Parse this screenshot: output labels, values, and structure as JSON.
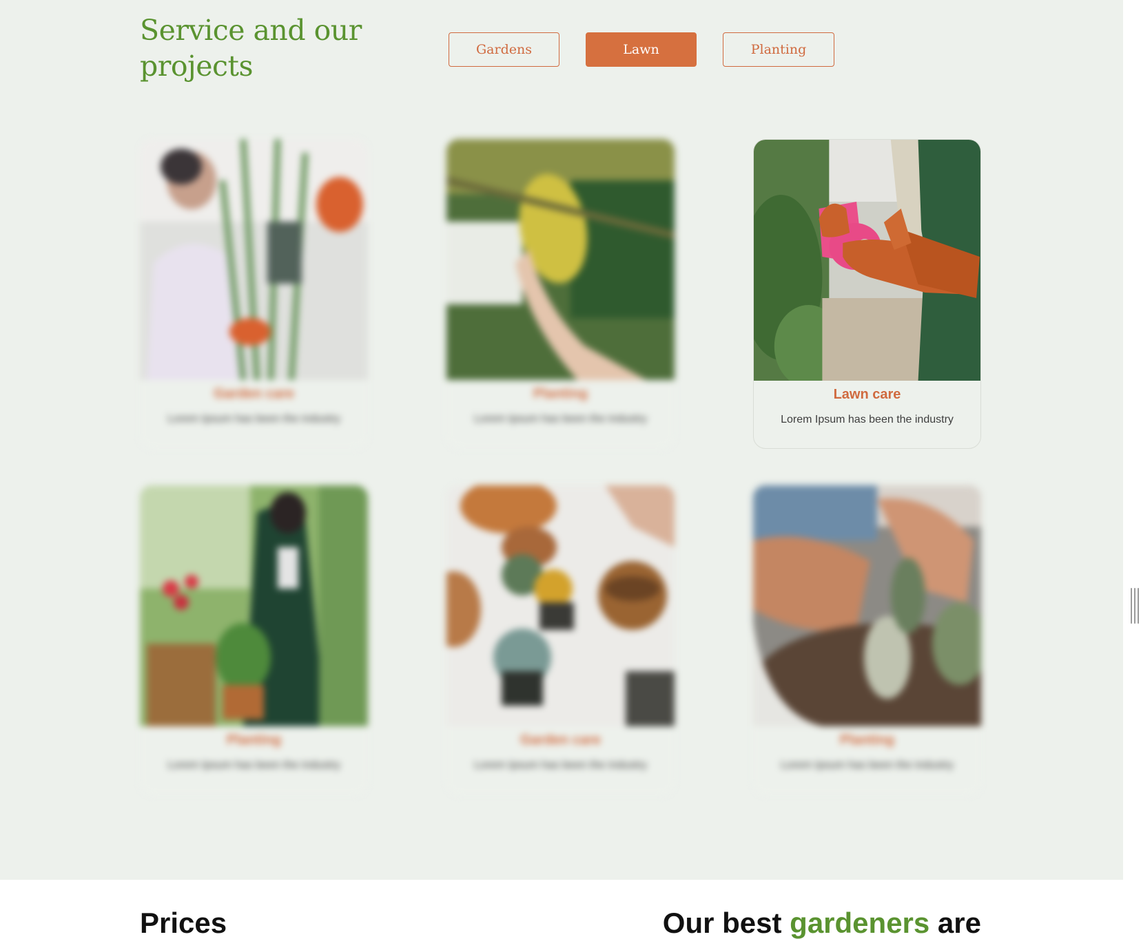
{
  "services": {
    "title": "Service and our projects",
    "filters": [
      {
        "label": "Gardens",
        "active": false
      },
      {
        "label": "Lawn",
        "active": true
      },
      {
        "label": "Planting",
        "active": false
      }
    ],
    "cards": [
      {
        "title": "Garden care",
        "description": "Lorem Ipsum has been the industry",
        "image": "gardener-with-plants-photo",
        "blurred": true
      },
      {
        "title": "Planting",
        "description": "Lorem Ipsum has been the industry",
        "image": "hand-holding-lemon-photo",
        "blurred": true
      },
      {
        "title": "Lawn care",
        "description": "Lorem Ipsum has been the industry",
        "image": "gloved-hands-spray-bottle-photo",
        "blurred": false
      },
      {
        "title": "Planting",
        "description": "Lorem Ipsum has been the industry",
        "image": "woman-potting-flowers-photo",
        "blurred": true
      },
      {
        "title": "Garden care",
        "description": "Lorem Ipsum has been the industry",
        "image": "succulent-pots-table-photo",
        "blurred": true
      },
      {
        "title": "Planting",
        "description": "Lorem Ipsum has been the industry",
        "image": "hands-planting-cactus-photo",
        "blurred": true
      }
    ]
  },
  "prices": {
    "title": "Prices"
  },
  "gardeners": {
    "title_before": "Our best ",
    "title_accent": "gardeners",
    "title_after": " are"
  },
  "colors": {
    "accent_orange": "#d6703f",
    "accent_green": "#5a9330",
    "section_bg": "#edf1ec"
  }
}
